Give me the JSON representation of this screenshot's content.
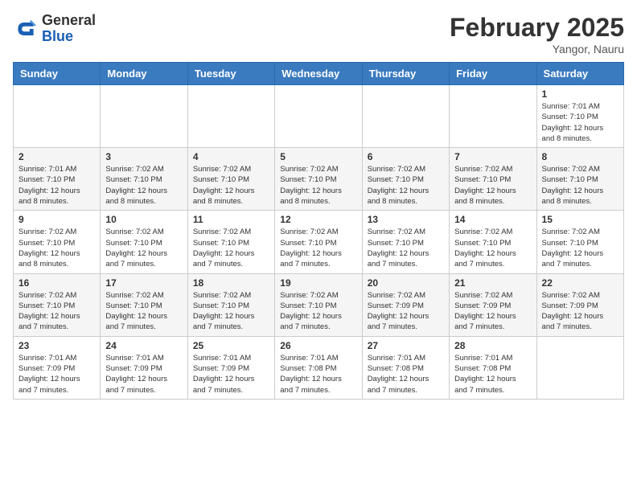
{
  "header": {
    "logo_general": "General",
    "logo_blue": "Blue",
    "month_title": "February 2025",
    "location": "Yangor, Nauru"
  },
  "weekdays": [
    "Sunday",
    "Monday",
    "Tuesday",
    "Wednesday",
    "Thursday",
    "Friday",
    "Saturday"
  ],
  "weeks": [
    [
      {
        "day": "",
        "info": ""
      },
      {
        "day": "",
        "info": ""
      },
      {
        "day": "",
        "info": ""
      },
      {
        "day": "",
        "info": ""
      },
      {
        "day": "",
        "info": ""
      },
      {
        "day": "",
        "info": ""
      },
      {
        "day": "1",
        "info": "Sunrise: 7:01 AM\nSunset: 7:10 PM\nDaylight: 12 hours\nand 8 minutes."
      }
    ],
    [
      {
        "day": "2",
        "info": "Sunrise: 7:01 AM\nSunset: 7:10 PM\nDaylight: 12 hours\nand 8 minutes."
      },
      {
        "day": "3",
        "info": "Sunrise: 7:02 AM\nSunset: 7:10 PM\nDaylight: 12 hours\nand 8 minutes."
      },
      {
        "day": "4",
        "info": "Sunrise: 7:02 AM\nSunset: 7:10 PM\nDaylight: 12 hours\nand 8 minutes."
      },
      {
        "day": "5",
        "info": "Sunrise: 7:02 AM\nSunset: 7:10 PM\nDaylight: 12 hours\nand 8 minutes."
      },
      {
        "day": "6",
        "info": "Sunrise: 7:02 AM\nSunset: 7:10 PM\nDaylight: 12 hours\nand 8 minutes."
      },
      {
        "day": "7",
        "info": "Sunrise: 7:02 AM\nSunset: 7:10 PM\nDaylight: 12 hours\nand 8 minutes."
      },
      {
        "day": "8",
        "info": "Sunrise: 7:02 AM\nSunset: 7:10 PM\nDaylight: 12 hours\nand 8 minutes."
      }
    ],
    [
      {
        "day": "9",
        "info": "Sunrise: 7:02 AM\nSunset: 7:10 PM\nDaylight: 12 hours\nand 8 minutes."
      },
      {
        "day": "10",
        "info": "Sunrise: 7:02 AM\nSunset: 7:10 PM\nDaylight: 12 hours\nand 7 minutes."
      },
      {
        "day": "11",
        "info": "Sunrise: 7:02 AM\nSunset: 7:10 PM\nDaylight: 12 hours\nand 7 minutes."
      },
      {
        "day": "12",
        "info": "Sunrise: 7:02 AM\nSunset: 7:10 PM\nDaylight: 12 hours\nand 7 minutes."
      },
      {
        "day": "13",
        "info": "Sunrise: 7:02 AM\nSunset: 7:10 PM\nDaylight: 12 hours\nand 7 minutes."
      },
      {
        "day": "14",
        "info": "Sunrise: 7:02 AM\nSunset: 7:10 PM\nDaylight: 12 hours\nand 7 minutes."
      },
      {
        "day": "15",
        "info": "Sunrise: 7:02 AM\nSunset: 7:10 PM\nDaylight: 12 hours\nand 7 minutes."
      }
    ],
    [
      {
        "day": "16",
        "info": "Sunrise: 7:02 AM\nSunset: 7:10 PM\nDaylight: 12 hours\nand 7 minutes."
      },
      {
        "day": "17",
        "info": "Sunrise: 7:02 AM\nSunset: 7:10 PM\nDaylight: 12 hours\nand 7 minutes."
      },
      {
        "day": "18",
        "info": "Sunrise: 7:02 AM\nSunset: 7:10 PM\nDaylight: 12 hours\nand 7 minutes."
      },
      {
        "day": "19",
        "info": "Sunrise: 7:02 AM\nSunset: 7:10 PM\nDaylight: 12 hours\nand 7 minutes."
      },
      {
        "day": "20",
        "info": "Sunrise: 7:02 AM\nSunset: 7:09 PM\nDaylight: 12 hours\nand 7 minutes."
      },
      {
        "day": "21",
        "info": "Sunrise: 7:02 AM\nSunset: 7:09 PM\nDaylight: 12 hours\nand 7 minutes."
      },
      {
        "day": "22",
        "info": "Sunrise: 7:02 AM\nSunset: 7:09 PM\nDaylight: 12 hours\nand 7 minutes."
      }
    ],
    [
      {
        "day": "23",
        "info": "Sunrise: 7:01 AM\nSunset: 7:09 PM\nDaylight: 12 hours\nand 7 minutes."
      },
      {
        "day": "24",
        "info": "Sunrise: 7:01 AM\nSunset: 7:09 PM\nDaylight: 12 hours\nand 7 minutes."
      },
      {
        "day": "25",
        "info": "Sunrise: 7:01 AM\nSunset: 7:09 PM\nDaylight: 12 hours\nand 7 minutes."
      },
      {
        "day": "26",
        "info": "Sunrise: 7:01 AM\nSunset: 7:08 PM\nDaylight: 12 hours\nand 7 minutes."
      },
      {
        "day": "27",
        "info": "Sunrise: 7:01 AM\nSunset: 7:08 PM\nDaylight: 12 hours\nand 7 minutes."
      },
      {
        "day": "28",
        "info": "Sunrise: 7:01 AM\nSunset: 7:08 PM\nDaylight: 12 hours\nand 7 minutes."
      },
      {
        "day": "",
        "info": ""
      }
    ]
  ]
}
